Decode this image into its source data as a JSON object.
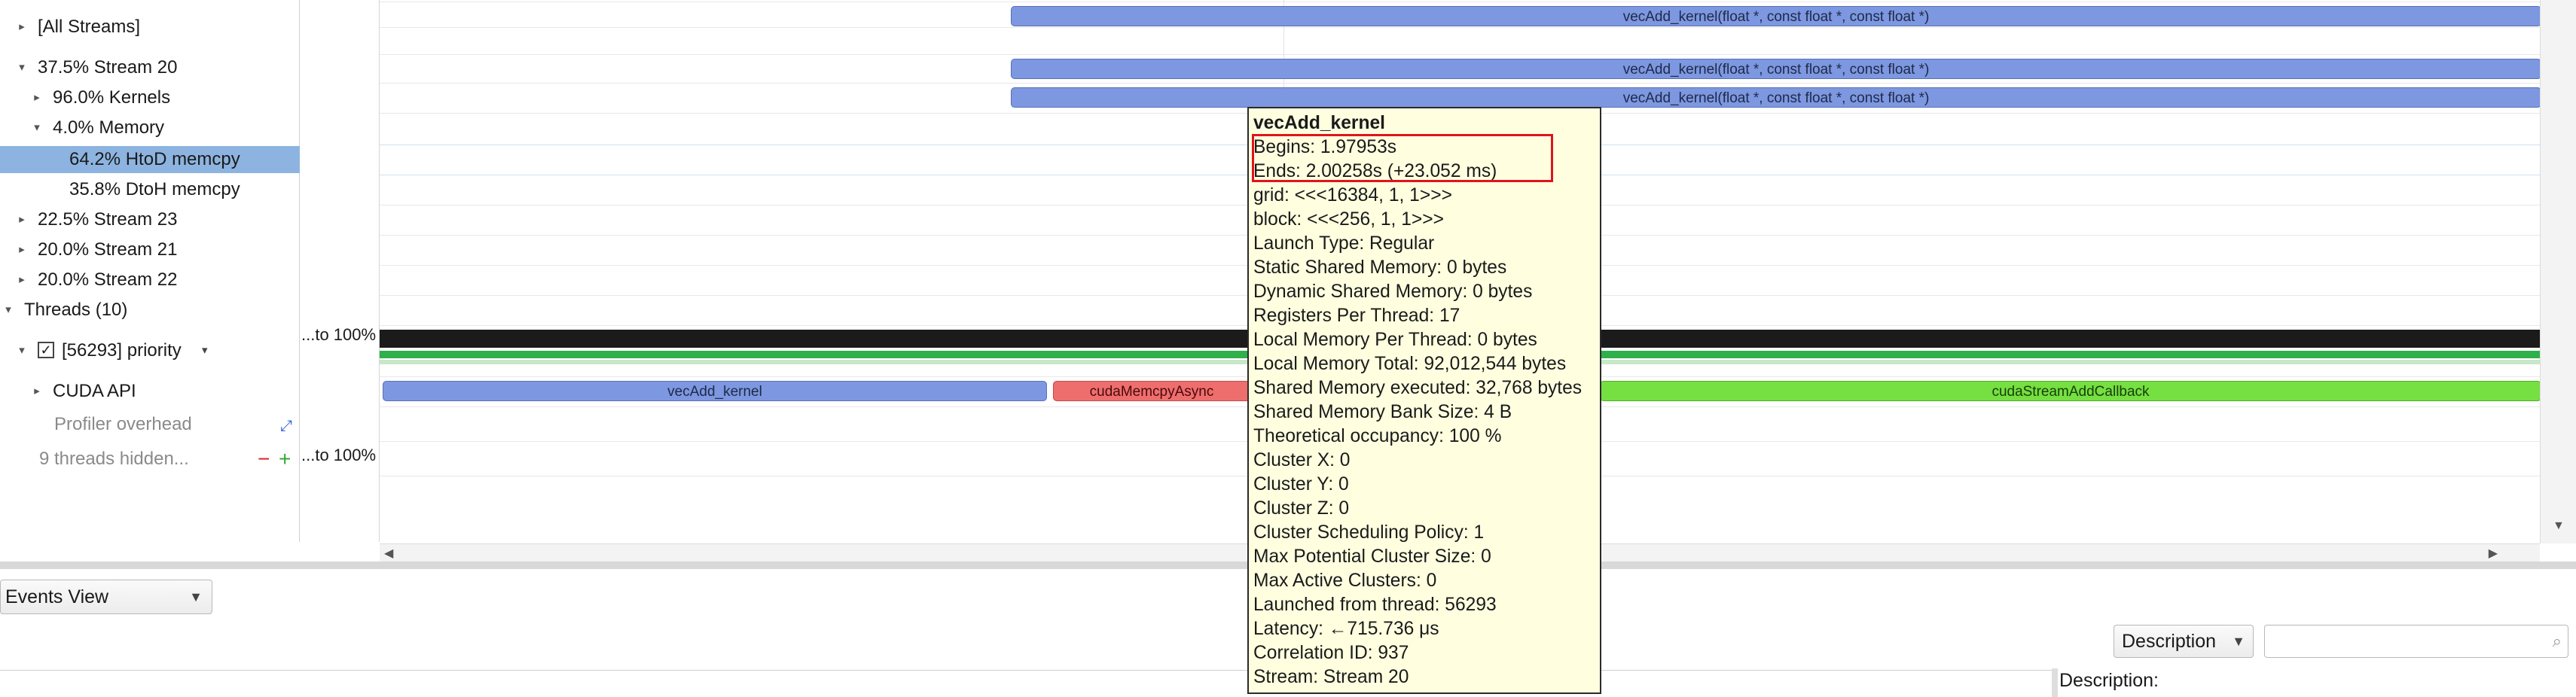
{
  "tree": {
    "all_streams": "[All Streams]",
    "stream20": "37.5% Stream 20",
    "kernels": "96.0% Kernels",
    "memory": "4.0% Memory",
    "htod": "64.2% HtoD memcpy",
    "dtoh": "35.8% DtoH memcpy",
    "stream23": "22.5% Stream 23",
    "stream21": "20.0% Stream 21",
    "stream22": "20.0% Stream 22",
    "threads": "Threads (10)",
    "thread_priority": "[56293] priority",
    "cuda_api": "CUDA API",
    "profiler_overhead": "Profiler overhead",
    "threads_hidden": "9 threads hidden..."
  },
  "metric": {
    "to100_a": "...to 100%",
    "to100_b": "...to 100%"
  },
  "timeline": {
    "kernel_full": "vecAdd_kernel(float *, const float *, const float *)",
    "cuda_vecadd": "vecAdd_kernel",
    "cuda_memcpy": "cudaMemcpyAsync",
    "cuda_callback": "cudaStreamAddCallback"
  },
  "tooltip": {
    "title": "vecAdd_kernel",
    "begins": "Begins: 1.97953s",
    "ends": "Ends: 2.00258s (+23.052 ms)",
    "lines": [
      "grid:  <<<16384, 1, 1>>>",
      "block: <<<256, 1, 1>>>",
      "Launch Type: Regular",
      "Static Shared Memory: 0 bytes",
      "Dynamic Shared Memory: 0 bytes",
      "Registers Per Thread: 17",
      "Local Memory Per Thread: 0 bytes",
      "Local Memory Total: 92,012,544 bytes",
      "Shared Memory executed: 32,768 bytes",
      "Shared Memory Bank Size: 4 B",
      "Theoretical occupancy: 100 %",
      "Cluster X: 0",
      "Cluster Y: 0",
      "Cluster Z: 0",
      "Cluster Scheduling Policy: 1",
      "Max Potential Cluster Size: 0",
      "Max Active Clusters: 0",
      "Launched from thread: 56293",
      "Latency: ←715.736 μs",
      "Correlation ID: 937",
      "Stream: Stream 20"
    ]
  },
  "bottom": {
    "events_view": "Events View",
    "description_select": "Description",
    "search_placeholder": "",
    "description_label": "Description:"
  },
  "icons": {
    "collapsed": "triangle-right-icon",
    "expanded": "triangle-down-icon",
    "checkbox": "checkbox-checked-icon",
    "link": "link-icon",
    "minus": "minus-icon",
    "plus": "plus-icon"
  },
  "colors": {
    "selection": "#8db4e0",
    "kernel_bar": "#7d97e0",
    "memcpy_bar": "#ee6e6e",
    "callback_bar": "#76df41",
    "tooltip_bg": "#ffffe0",
    "highlight": "#e0141c"
  }
}
